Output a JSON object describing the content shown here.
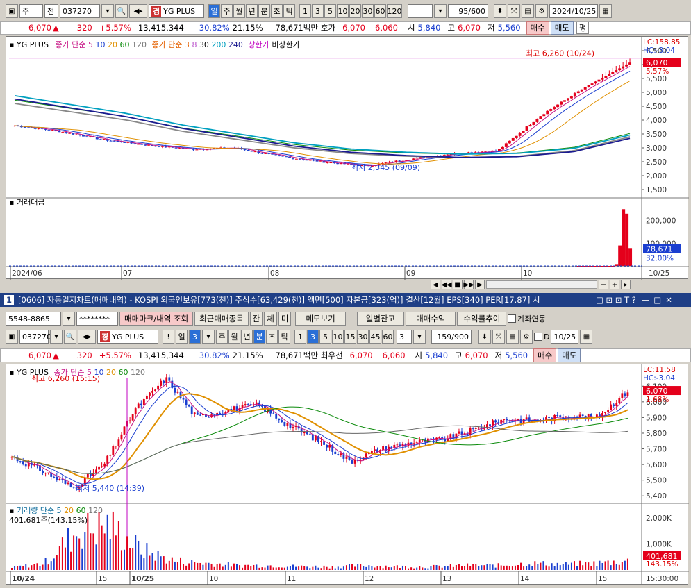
{
  "top": {
    "market_sel": "주",
    "jeon": "전",
    "code": "037270",
    "name_badge": "경",
    "name": "YG PLUS",
    "periods": [
      "일",
      "주",
      "월",
      "년",
      "분",
      "초",
      "틱"
    ],
    "active_period": "일",
    "nums": [
      "1",
      "3",
      "5",
      "10",
      "20",
      "30",
      "60",
      "120"
    ],
    "count": "95",
    "count_total": "/600",
    "date": "2024/10/25"
  },
  "quote": {
    "price": "6,070",
    "arrow": "▲",
    "change": "320",
    "pct": "+5.57%",
    "volume": "13,415,344",
    "vol_pct": "30.82%",
    "turnover": "21.15%",
    "amount": "78,671백만",
    "ho_label": "호가",
    "ask": "6,070",
    "bid": "6,060",
    "open_label": "시",
    "open": "5,840",
    "high_label": "고",
    "high": "6,070",
    "low_label": "저",
    "low": "5,560",
    "buy": "매수",
    "sell": "매도",
    "avg": "평"
  },
  "daily": {
    "legend": {
      "name": "YG PLUS",
      "ma_label1": "종가 단순 5",
      "ma1": [
        "10",
        "20",
        "60",
        "120"
      ],
      "ma_label2": "종가 단순 3",
      "ma2": [
        "8",
        "30",
        "200",
        "240"
      ],
      "upper": "상한가",
      "lower": "비상한가"
    },
    "lc": "LC:158.85",
    "hc": "HC:-3.04",
    "price_ticks": [
      "6,500",
      "6,000",
      "5,500",
      "5,000",
      "4,500",
      "4,000",
      "3,500",
      "3,000",
      "2,500",
      "2,000",
      "1,500"
    ],
    "current_tag": "6,070",
    "current_pct": "5.57%",
    "max_note": "최고 6,260 (10/24)",
    "min_note": "최저 2,345 (09/09)",
    "vol_title": "거래대금",
    "vol_ticks": [
      "200,000",
      "100,000"
    ],
    "vol_tag": "78,671",
    "vol_pct": "32.00%",
    "dates": [
      "2024/06",
      "07",
      "08",
      "09",
      "10"
    ],
    "right_date": "10/25"
  },
  "window2": {
    "num": "1",
    "title": "[0606] 자동일지차트(매매내역) - KOSPI 외국인보유[773(천)] 주식수[63,429(천)] 액면[500] 자본금[323(억)] 결산[12월] EPS[340] PER[17.87] 시"
  },
  "acct": {
    "account": "5548-8865",
    "password": "********",
    "btn_mark": "매매마크/내역 조회",
    "btn_recent": "최근매매종목",
    "b_jan": "잔",
    "b_che": "체",
    "b_mi": "미",
    "btn_memo": "메모보기",
    "btn_daily": "일별잔고",
    "btn_profit": "매매수익",
    "btn_return": "수익률추이",
    "chk_link": "계좌연동"
  },
  "top2": {
    "code": "037270",
    "name_badge": "경",
    "name": "YG PLUS",
    "excl": "!",
    "day": "일",
    "day_num": "3",
    "periods": [
      "주",
      "월",
      "년",
      "분",
      "초",
      "틱"
    ],
    "active_period": "분",
    "nums": [
      "1",
      "3",
      "5",
      "10",
      "15",
      "30",
      "45",
      "60"
    ],
    "sel_num": "3",
    "interval": "3",
    "count": "159",
    "count_total": "/900",
    "d_label": "D",
    "date": "10/25"
  },
  "quote2": {
    "price": "6,070",
    "arrow": "▲",
    "change": "320",
    "pct": "+5.57%",
    "volume": "13,415,344",
    "vol_pct": "30.82%",
    "turnover": "21.15%",
    "amount": "78,671백만",
    "best_label": "최우선",
    "ask": "6,070",
    "bid": "6,060",
    "open_label": "시",
    "open": "5,840",
    "high_label": "고",
    "high": "6,070",
    "low_label": "저",
    "low": "5,560",
    "buy": "매수",
    "sell": "매도"
  },
  "minute": {
    "legend": {
      "name": "YG PLUS",
      "ma_label": "종가 단순 5",
      "ma": [
        "10",
        "20",
        "60",
        "120"
      ]
    },
    "lc": "LC:11.58",
    "hc": "HC:-3.04",
    "price_ticks": [
      "6,100",
      "6,000",
      "5,900",
      "5,800",
      "5,700",
      "5,600",
      "5,500",
      "5,400"
    ],
    "current_tag": "6,070",
    "current_pct": "1.68%",
    "max_note": "최고 6,260 (15:15)",
    "min_note": "최저 5,440 (14:39)",
    "vol_title": "거래량 단순 5",
    "vol_ma": [
      "20",
      "60",
      "120"
    ],
    "vol_line": "401,681주(143.15%)",
    "vol_ticks": [
      "2,000K",
      "1,000K"
    ],
    "vol_tag": "401,681",
    "vol_pct": "143.15%",
    "dates": [
      "10/24",
      "15",
      "10/25",
      "10",
      "11",
      "12",
      "13",
      "14",
      "15"
    ],
    "right_time": "15:30:00"
  },
  "chart_data": [
    {
      "type": "candlestick",
      "title": "YG PLUS",
      "ylim": [
        1300,
        6500
      ],
      "x": [
        "2024/06",
        "07",
        "08",
        "09",
        "10"
      ],
      "close_approx": [
        3800,
        3600,
        3300,
        3100,
        2950,
        3000,
        2700,
        2500,
        2345,
        2600,
        2800,
        2900,
        4200,
        5200,
        6070
      ],
      "max": 6260,
      "min": 2345,
      "volume_approx": [
        0,
        0,
        0,
        0,
        0,
        0,
        0,
        0,
        0,
        0,
        0,
        5000,
        90000,
        250000,
        230000,
        78671
      ],
      "vol_ylim": [
        0,
        260000
      ]
    },
    {
      "type": "candlestick",
      "title": "YG PLUS",
      "ylim": [
        5370,
        6150
      ],
      "x": [
        "10/24",
        "15",
        "10/25",
        "10",
        "11",
        "12",
        "13",
        "14",
        "15"
      ],
      "close_approx": [
        5650,
        5560,
        5450,
        5600,
        5950,
        6150,
        5900,
        5950,
        5980,
        5850,
        5750,
        5620,
        5700,
        5740,
        5760,
        5820,
        5890,
        5880,
        5910,
        5900,
        6070
      ],
      "max": 6260,
      "min": 5440,
      "volume_approx": [
        100,
        300,
        1700,
        2000,
        900,
        400,
        300,
        200,
        200,
        150,
        150,
        200,
        150,
        150,
        200,
        200,
        300,
        250,
        300,
        401.681
      ],
      "vol_ylim": [
        0,
        2300
      ]
    }
  ]
}
